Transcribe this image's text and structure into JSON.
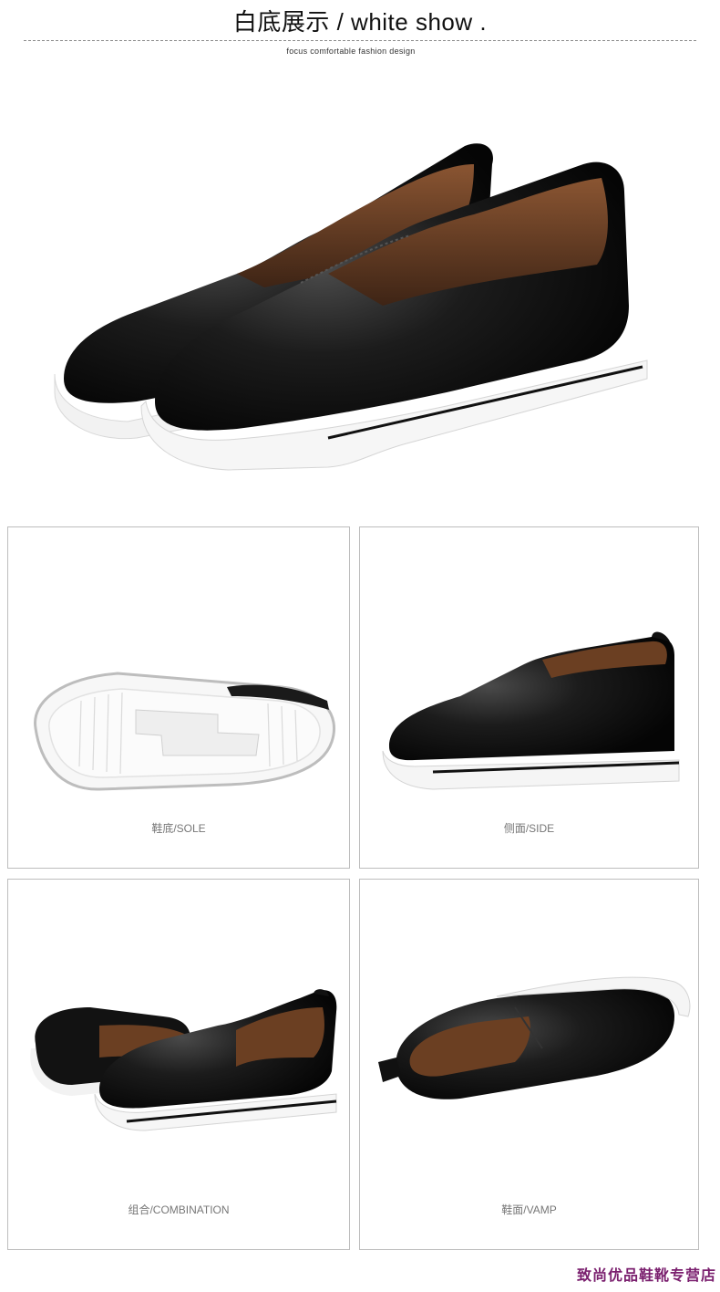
{
  "header": {
    "title": "白底展示 / white show .",
    "subtitle": "focus comfortable fashion design"
  },
  "panels": [
    {
      "caption": "鞋底/SOLE"
    },
    {
      "caption": "侧面/SIDE"
    },
    {
      "caption": "组合/COMBINATION"
    },
    {
      "caption": "鞋面/VAMP"
    }
  ],
  "footer": {
    "shop_name": "致尚优品鞋靴专营店"
  },
  "colors": {
    "leather": "#141414",
    "fur_lining": "#6b3f22",
    "sole": "#f4f4f4",
    "shop_name": "#7a1f6e"
  }
}
